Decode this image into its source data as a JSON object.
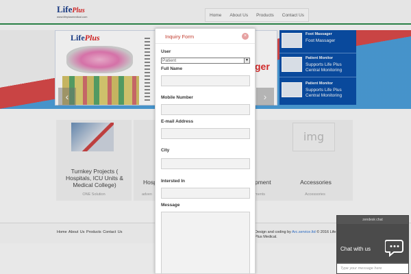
{
  "header": {
    "logo_main": "Life",
    "logo_accent": "Plus",
    "logo_tagline": "www.lifeplusmedical.com",
    "nav": [
      "Home",
      "About Us",
      "Products",
      "Contact Us"
    ]
  },
  "hero": {
    "banner_logo_main": "Life",
    "banner_logo_accent": "Plus",
    "banner_red_text": "ger",
    "prev_icon": "‹",
    "next_icon": "›",
    "side_panels": [
      {
        "title": "Foot Massager",
        "subtitle": "Foot Massager"
      },
      {
        "title": "Patient Monitor",
        "subtitle": "Supports Life Plus Central Monitoring"
      },
      {
        "title": "Patient Monitor",
        "subtitle": "Supports Life Plus Central Monitoring"
      }
    ]
  },
  "cards": [
    {
      "title": "Turnkey Projects ( Hospitals, ICU Units & Medical College)",
      "subtitle": "ONE Solution",
      "placeholder": ""
    },
    {
      "title": "Hosp",
      "subtitle": "adven",
      "placeholder": ""
    },
    {
      "title": "pment",
      "subtitle": "ments",
      "placeholder": ""
    },
    {
      "title": "Accessories",
      "subtitle": "Accessories",
      "placeholder": "img"
    }
  ],
  "footer": {
    "links": "Home  About Us  Products  Contact Us",
    "copy_prefix": "Design and coding by",
    "developer": "Arc.service.ltd",
    "copy_suffix": "© 2016 Life Plus Medical."
  },
  "modal": {
    "title": "Inquiry Form",
    "close_icon": "×",
    "user_label": "User",
    "user_value": "Patient",
    "full_name_label": "Full Name",
    "mobile_label": "Mobile Number",
    "email_label": "E-mail Address",
    "city_label": "City",
    "interest_label": "Intersted In",
    "message_label": "Message"
  },
  "chat": {
    "brand": "zendesk chat",
    "title": "Chat with us",
    "input_placeholder": "Type your message here"
  }
}
